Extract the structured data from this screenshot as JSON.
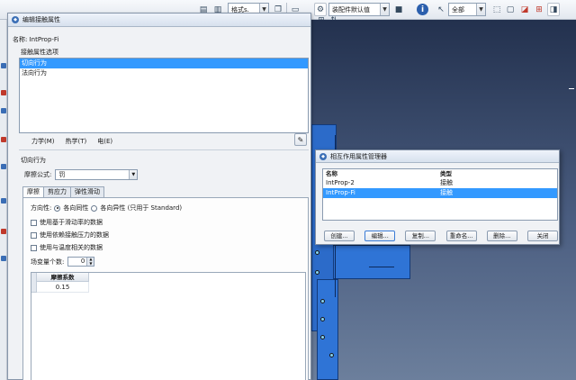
{
  "toolbar": {
    "partial_combo_text": "格式s.",
    "assembly_combo_value": "装配件默认值",
    "select_combo_value": "全部"
  },
  "edit_dialog": {
    "title": "编辑接触属性",
    "name_label": "名称:",
    "name_value": "IntProp-Fi",
    "options_label": "接触属性选项",
    "options": [
      "切向行为",
      "法向行为"
    ],
    "selected_option_index": 0,
    "menus": [
      "力学(M)",
      "热学(T)",
      "电(E)"
    ],
    "behavior_title": "切向行为",
    "friction_label": "摩擦公式:",
    "friction_value": "罚",
    "tabs": [
      "摩擦",
      "剪应力",
      "弹性滑动"
    ],
    "active_tab_index": 0,
    "direction_label": "方向性:",
    "direction_options": [
      "各向同性",
      "各向异性 (只用于 Standard)"
    ],
    "direction_selected_index": 0,
    "checkboxes": [
      "使用基于滑动率的数据",
      "使用依赖接触压力的数据",
      "使用与温度相关的数据"
    ],
    "field_vars_label": "场变量个数:",
    "field_vars_value": "0",
    "table_header": "摩擦系数",
    "table_values": [
      "0.15"
    ]
  },
  "manager": {
    "title": "相互作用属性管理器",
    "col_name": "名称",
    "col_type": "类型",
    "rows": [
      {
        "name": "IntProp-2",
        "type": "接触"
      },
      {
        "name": "IntProp-Fi",
        "type": "接触"
      }
    ],
    "selected_row_index": 1,
    "buttons": [
      "创建...",
      "编辑...",
      "复制...",
      "重命名...",
      "删除...",
      "关闭"
    ]
  },
  "colors": {
    "selection": "#3399ff",
    "model_blue": "#2f74d6",
    "viewport_top": "#23314e"
  }
}
